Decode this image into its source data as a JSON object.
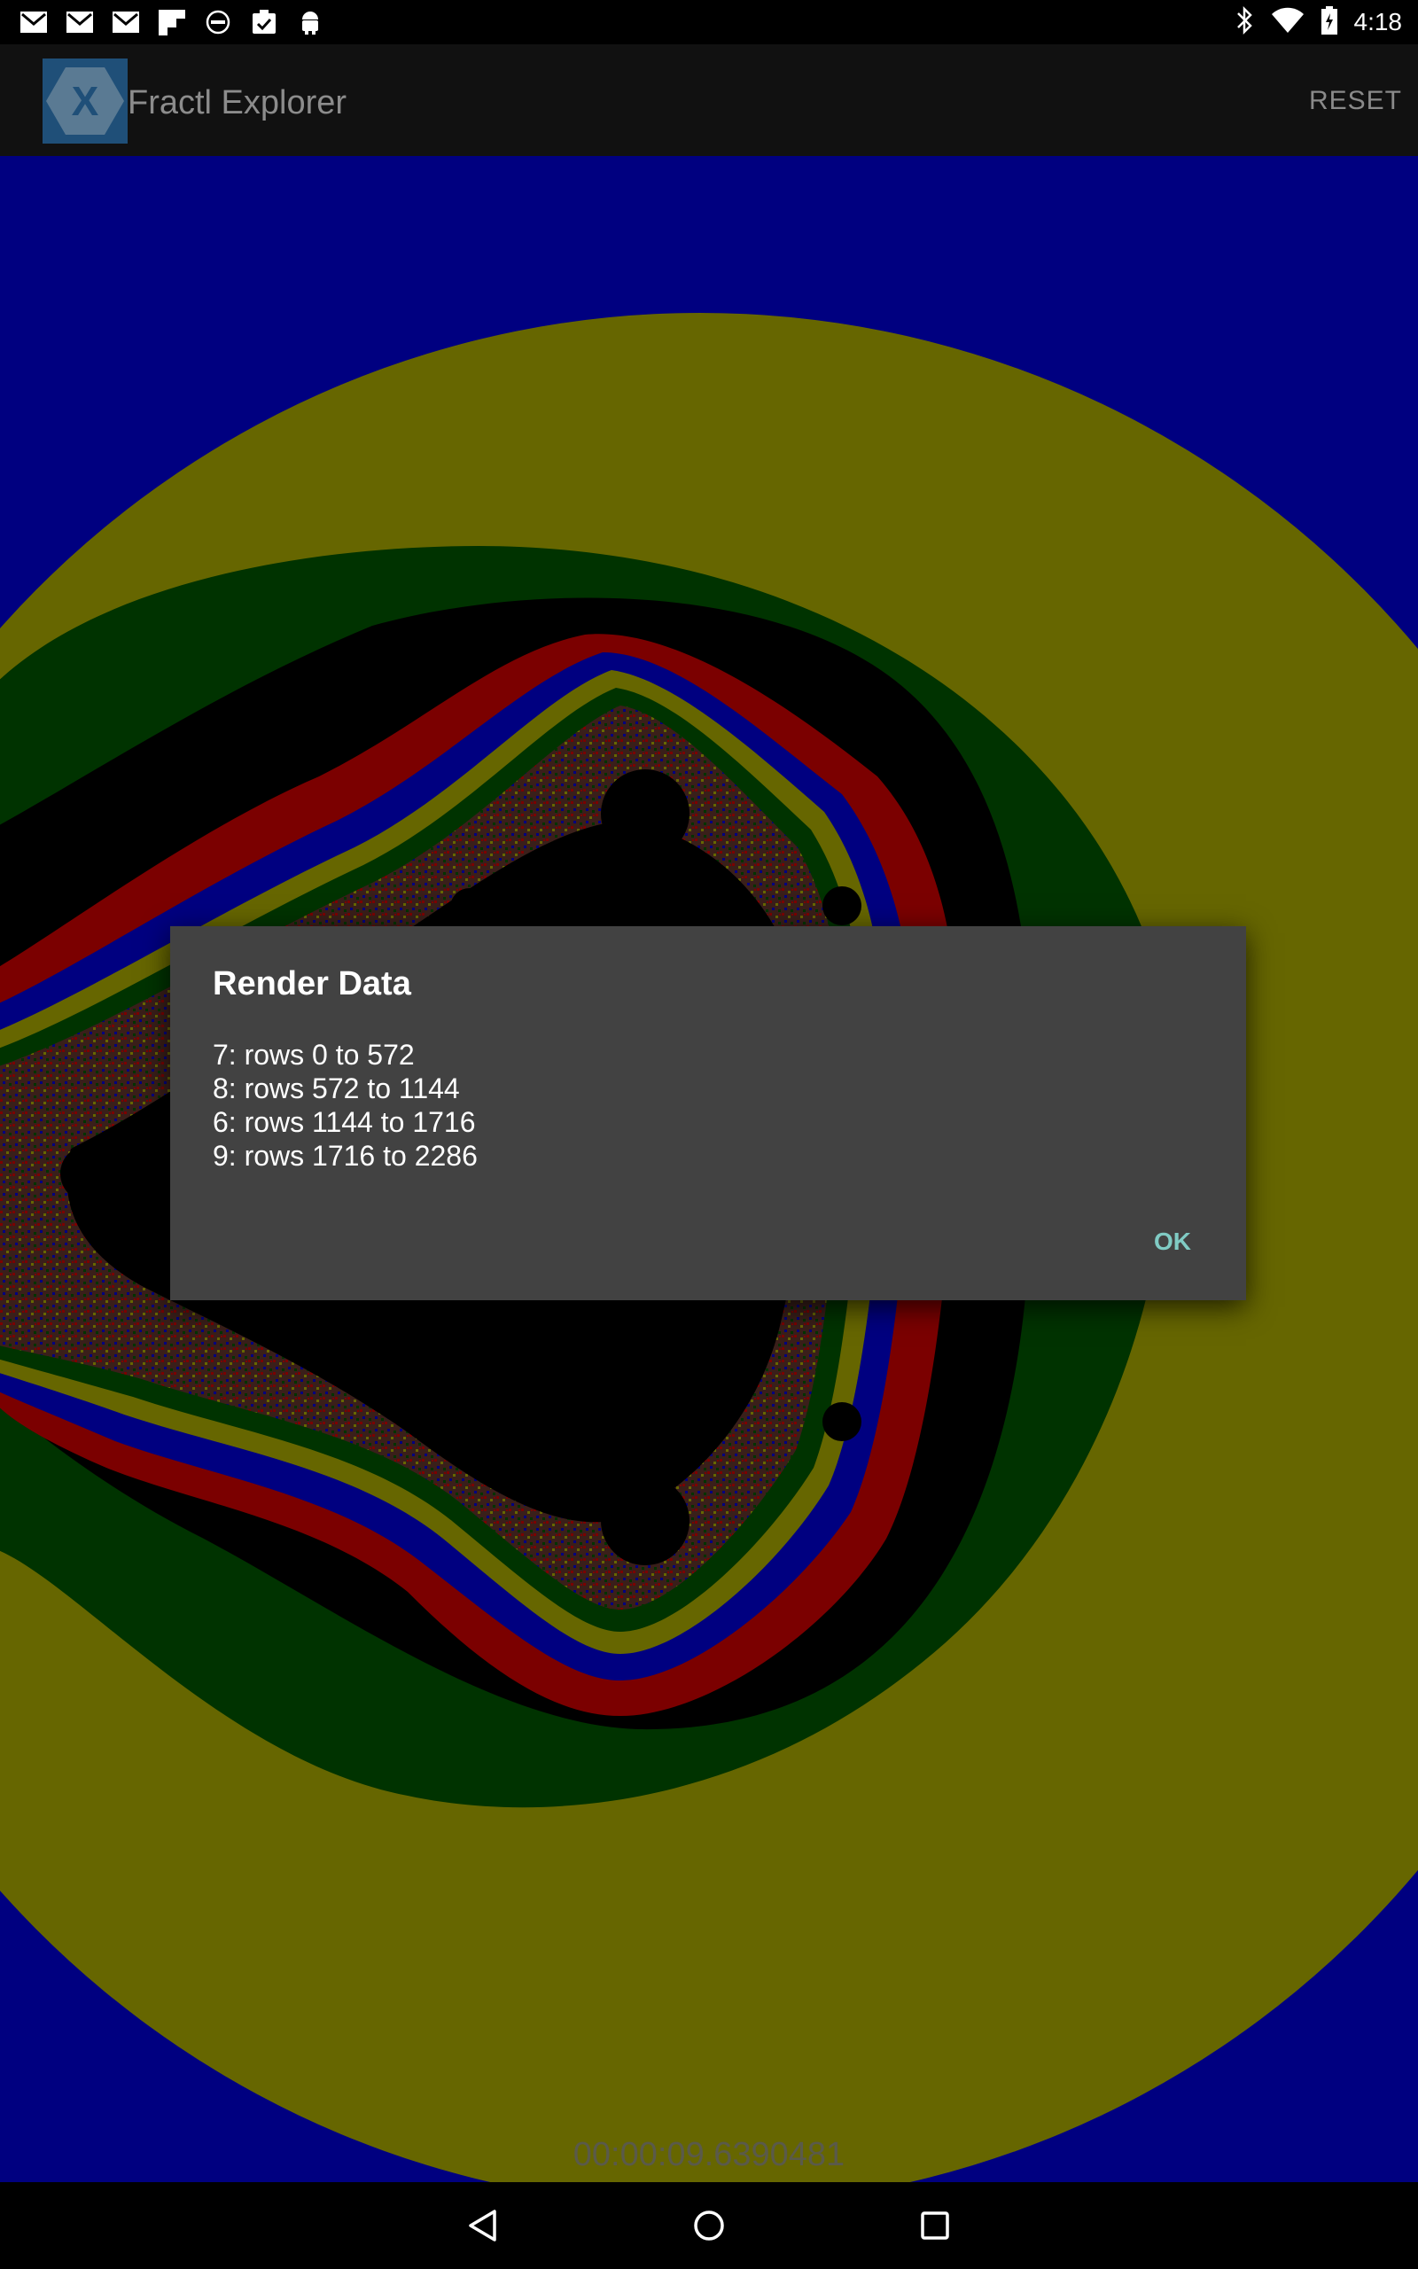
{
  "status_bar": {
    "time": "4:18",
    "left_icons": [
      "gmail-icon",
      "gmail-icon",
      "gmail-icon",
      "flipboard-icon",
      "dell-icon",
      "clipboard-check-icon",
      "android-debug-icon"
    ],
    "right_icons": [
      "bluetooth-icon",
      "wifi-icon",
      "battery-charging-icon"
    ]
  },
  "app_bar": {
    "title": "Fractl Explorer",
    "logo_letter": "X",
    "reset_label": "RESET"
  },
  "render": {
    "elapsed": "00:00:09.6390481",
    "colors": {
      "blue": "#000080",
      "yellow": "#666600",
      "green": "#003300",
      "red": "#7b0000",
      "black": "#000000"
    }
  },
  "dialog": {
    "title": "Render Data",
    "lines": [
      "7: rows 0 to 572",
      "8: rows 572 to 1144",
      "6: rows 1144 to 1716",
      "9: rows 1716 to 2286"
    ],
    "ok_label": "OK"
  },
  "nav_bar": {
    "buttons": [
      "back-icon",
      "home-icon",
      "recents-icon"
    ]
  }
}
